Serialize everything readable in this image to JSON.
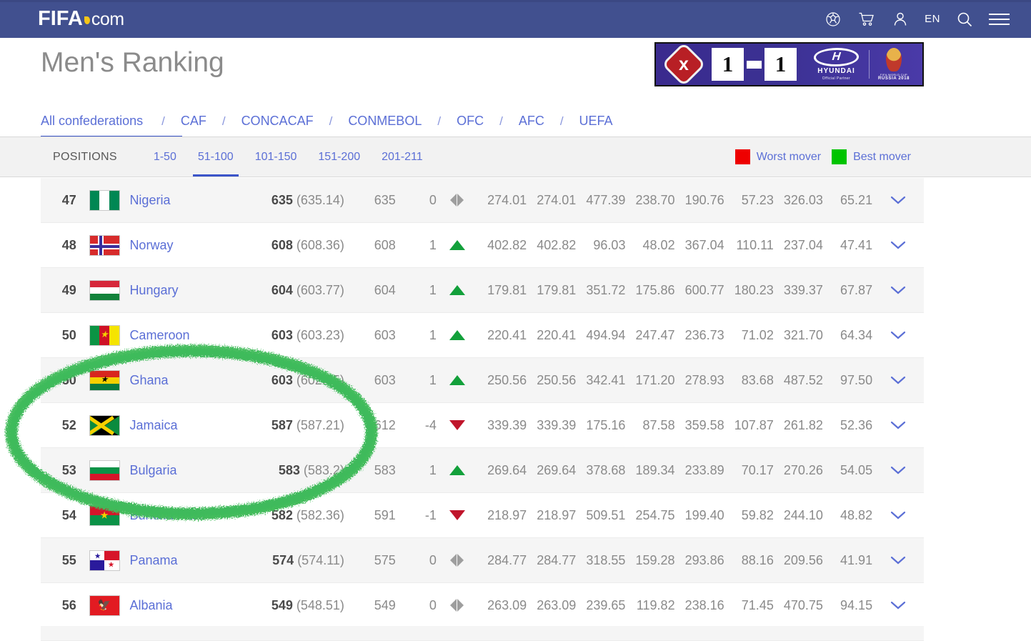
{
  "header": {
    "logo_fifa": "FIFA",
    "logo_com": "com",
    "lang": "EN",
    "icons": [
      "ball-icon",
      "cart-icon",
      "user-icon",
      "search-icon",
      "menu-icon"
    ]
  },
  "ad": {
    "close_label": "x",
    "score_home": "1",
    "score_away": "1",
    "sponsor_mark": "H",
    "sponsor_name": "HYUNDAI",
    "sponsor_sub": "Official Partner",
    "event_line1": "FIFA WORLD CUP",
    "event_line2": "RUSSIA 2018"
  },
  "page": {
    "title": "Men's Ranking"
  },
  "confederations": {
    "separator": "/",
    "items": [
      {
        "label": "All confederations",
        "active": true
      },
      {
        "label": "CAF",
        "active": false
      },
      {
        "label": "CONCACAF",
        "active": false
      },
      {
        "label": "CONMEBOL",
        "active": false
      },
      {
        "label": "OFC",
        "active": false
      },
      {
        "label": "AFC",
        "active": false
      },
      {
        "label": "UEFA",
        "active": false
      }
    ]
  },
  "positions": {
    "label": "POSITIONS",
    "ranges": [
      {
        "label": "1-50",
        "active": false
      },
      {
        "label": "51-100",
        "active": true
      },
      {
        "label": "101-150",
        "active": false
      },
      {
        "label": "151-200",
        "active": false
      },
      {
        "label": "201-211",
        "active": false
      }
    ]
  },
  "legend": {
    "worst_label": "Worst mover",
    "worst_color": "#ee0000",
    "best_label": "Best mover",
    "best_color": "#00c400"
  },
  "annotation": {
    "shape": "hand-drawn-oval",
    "color": "#3fba5a",
    "covers_rows": [
      "50 Ghana",
      "52 Jamaica",
      "53 Bulgaria",
      "54 Burkina Faso"
    ]
  },
  "rows": [
    {
      "rank": "47",
      "team": "Nigeria",
      "flag": "nigeria",
      "points": "635",
      "points_exact": "(635.14)",
      "previous": "635",
      "delta": "0",
      "trend": "same",
      "nums": [
        "274.01",
        "274.01",
        "477.39",
        "238.70",
        "190.76",
        "57.23",
        "326.03",
        "65.21"
      ]
    },
    {
      "rank": "48",
      "team": "Norway",
      "flag": "norway",
      "points": "608",
      "points_exact": "(608.36)",
      "previous": "608",
      "delta": "1",
      "trend": "up",
      "nums": [
        "402.82",
        "402.82",
        "96.03",
        "48.02",
        "367.04",
        "110.11",
        "237.04",
        "47.41"
      ]
    },
    {
      "rank": "49",
      "team": "Hungary",
      "flag": "hungary",
      "points": "604",
      "points_exact": "(603.77)",
      "previous": "604",
      "delta": "1",
      "trend": "up",
      "nums": [
        "179.81",
        "179.81",
        "351.72",
        "175.86",
        "600.77",
        "180.23",
        "339.37",
        "67.87"
      ]
    },
    {
      "rank": "50",
      "team": "Cameroon",
      "flag": "cameroon",
      "points": "603",
      "points_exact": "(603.23)",
      "previous": "603",
      "delta": "1",
      "trend": "up",
      "nums": [
        "220.41",
        "220.41",
        "494.94",
        "247.47",
        "236.73",
        "71.02",
        "321.70",
        "64.34"
      ]
    },
    {
      "rank": "50",
      "team": "Ghana",
      "flag": "ghana",
      "points": "603",
      "points_exact": "(602.95)",
      "previous": "603",
      "delta": "1",
      "trend": "up",
      "nums": [
        "250.56",
        "250.56",
        "342.41",
        "171.20",
        "278.93",
        "83.68",
        "487.52",
        "97.50"
      ]
    },
    {
      "rank": "52",
      "team": "Jamaica",
      "flag": "jamaica",
      "points": "587",
      "points_exact": "(587.21)",
      "previous": "612",
      "delta": "-4",
      "trend": "down",
      "nums": [
        "339.39",
        "339.39",
        "175.16",
        "87.58",
        "359.58",
        "107.87",
        "261.82",
        "52.36"
      ]
    },
    {
      "rank": "53",
      "team": "Bulgaria",
      "flag": "bulgaria",
      "points": "583",
      "points_exact": "(583.2)",
      "previous": "583",
      "delta": "1",
      "trend": "up",
      "nums": [
        "269.64",
        "269.64",
        "378.68",
        "189.34",
        "233.89",
        "70.17",
        "270.26",
        "54.05"
      ]
    },
    {
      "rank": "54",
      "team": "Burkina Faso",
      "flag": "burkinafaso",
      "points": "582",
      "points_exact": "(582.36)",
      "previous": "591",
      "delta": "-1",
      "trend": "down",
      "nums": [
        "218.97",
        "218.97",
        "509.51",
        "254.75",
        "199.40",
        "59.82",
        "244.10",
        "48.82"
      ]
    },
    {
      "rank": "55",
      "team": "Panama",
      "flag": "panama",
      "points": "574",
      "points_exact": "(574.11)",
      "previous": "575",
      "delta": "0",
      "trend": "same",
      "nums": [
        "284.77",
        "284.77",
        "318.55",
        "159.28",
        "293.86",
        "88.16",
        "209.56",
        "41.91"
      ]
    },
    {
      "rank": "56",
      "team": "Albania",
      "flag": "albania",
      "points": "549",
      "points_exact": "(548.51)",
      "previous": "549",
      "delta": "0",
      "trend": "same",
      "nums": [
        "263.09",
        "263.09",
        "239.65",
        "119.82",
        "238.16",
        "71.45",
        "470.75",
        "94.15"
      ]
    }
  ]
}
